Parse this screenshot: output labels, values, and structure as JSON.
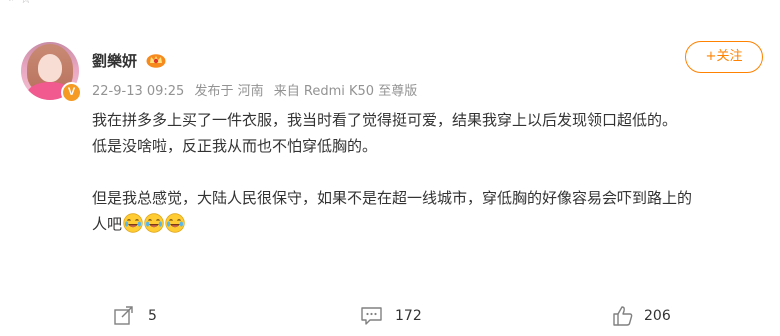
{
  "post": {
    "username": "劉樂妍",
    "timestamp": "22-9-13 09:25",
    "location": "发布于 河南",
    "source": "来自 Redmi K50 至尊版",
    "follow_label": "+关注",
    "paragraphs": [
      "我在拼多多上买了一件衣服，我当时看了觉得挺可爱，结果我穿上以后发现领口超低的。",
      "低是没啥啦，反正我从而也不怕穿低胸的。",
      "",
      "但是我总感觉，大陆人民很保守，如果不是在超一线城市，穿低胸的好像容易会吓到路上的人吧"
    ],
    "emojis": [
      "laugh-cry",
      "laugh-cry",
      "laugh-cry"
    ]
  },
  "actions": {
    "share_count": "5",
    "comment_count": "172",
    "like_count": "206"
  },
  "colors": {
    "accent": "#ff8200",
    "meta_text": "#939393",
    "body_text": "#333333",
    "verified_badge": "#f59a23"
  },
  "icons": {
    "verified": "v-badge-icon",
    "vip": "vip-crown-icon",
    "share": "share-icon",
    "comment": "comment-icon",
    "like": "thumbs-up-icon",
    "emoji": "laugh-cry-emoji-icon"
  }
}
